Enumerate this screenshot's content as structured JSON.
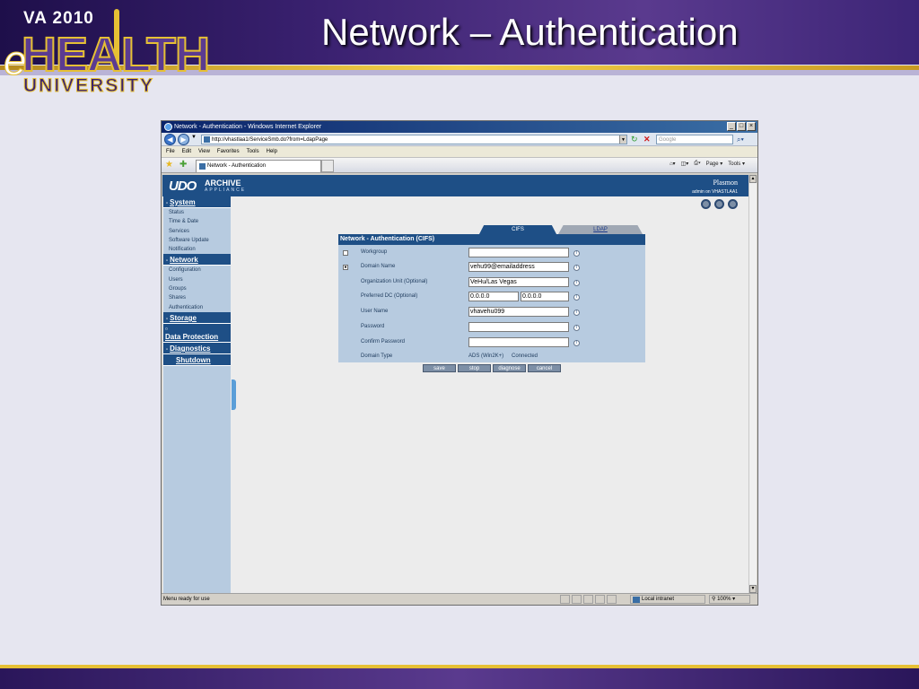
{
  "slide": {
    "title": "Network – Authentication",
    "logo_va": "VA 2010",
    "logo_e": "e",
    "logo_health": "HEALTH",
    "logo_university": "UNIVERSITY"
  },
  "browser": {
    "window_title": "Network - Authentication - Windows Internet Explorer",
    "address": "http://vhastlaa1/ServiceSmb.do?from=LdapPage",
    "search_placeholder": "Google",
    "menu": [
      "File",
      "Edit",
      "View",
      "Favorites",
      "Tools",
      "Help"
    ],
    "tab_title": "Network - Authentication",
    "cmd_page": "Page",
    "cmd_tools": "Tools",
    "status": "Menu ready for use",
    "zone": "Local intranet",
    "zoom": "100%"
  },
  "app": {
    "brand_udo": "UDO",
    "brand_archive": "ARCHIVE",
    "brand_appliance": "APPLIANCE",
    "vendor": "Plasmon",
    "user": "admin on VHASTLAA1",
    "sidebar": {
      "system": "System",
      "system_items": [
        "Status",
        "Time & Date",
        "Services",
        "Software Update",
        "Notification"
      ],
      "network": "Network",
      "network_items": [
        "Configuration",
        "Users",
        "Groups",
        "Shares",
        "Authentication"
      ],
      "storage": "Storage",
      "data_protection": "Data Protection",
      "diagnostics": "Diagnostics",
      "shutdown": "Shutdown"
    },
    "tabs": {
      "cifs": "CIFS",
      "ldap": "LDAP"
    },
    "panel_title": "Network - Authentication (CIFS)",
    "form": {
      "workgroup_label": "Workgroup",
      "workgroup_value": "",
      "domain_label": "Domain Name",
      "domain_value": "vehu99@emailaddress",
      "ou_label": "Organization Unit (Optional)",
      "ou_value": "VeHu/Las Vegas",
      "dc_label": "Preferred DC (Optional)",
      "dc_value1": "0.0.0.0",
      "dc_value2": "0.0.0.0",
      "user_label": "User Name",
      "user_value": "vhavehu099",
      "password_label": "Password",
      "password_value": "",
      "confirm_label": "Confirm Password",
      "confirm_value": "",
      "domain_type_label": "Domain Type",
      "domain_type_value": "ADS (Win2K+)",
      "domain_status": "Connected"
    },
    "buttons": {
      "save": "save",
      "stop": "stop",
      "diagnose": "diagnose",
      "cancel": "cancel"
    }
  }
}
